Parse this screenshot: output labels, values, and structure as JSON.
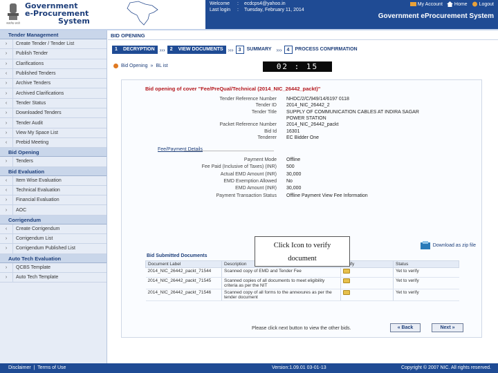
{
  "header": {
    "brand_line1": "Government",
    "brand_line2": "e-Procurement",
    "brand_line3": "System",
    "emblem_caption": "सत्यमेव जयते",
    "welcome_label": "Welcome",
    "welcome_value": "ecdcps4@yahoo.in",
    "last_login_label": "Last login",
    "last_login_value": "Tuesday, February 11, 2014",
    "my_account": "My Account",
    "home": "Home",
    "logout": "Logout",
    "system_title": "Government eProcurement System"
  },
  "sidebar": {
    "sections": [
      {
        "title": "Tender Management",
        "items": [
          {
            "bullet": "›",
            "label": "Create Tender / Tender List"
          },
          {
            "bullet": "›",
            "label": "Publish Tender"
          },
          {
            "bullet": "›",
            "label": "Clarifications"
          },
          {
            "bullet": "‹",
            "label": "Published Tenders"
          },
          {
            "bullet": "›",
            "label": "Archive Tenders"
          },
          {
            "bullet": "›",
            "label": "Archived Clarifications"
          },
          {
            "bullet": "‹",
            "label": "Tender Status"
          },
          {
            "bullet": "›",
            "label": "Downloaded Tenders"
          },
          {
            "bullet": "›",
            "label": "Tender Audit"
          },
          {
            "bullet": "›",
            "label": "View My Space List"
          },
          {
            "bullet": "‹",
            "label": "Prebid Meeting"
          }
        ]
      },
      {
        "title": "Bid Opening",
        "items": [
          {
            "bullet": "›",
            "label": "Tenders"
          }
        ]
      },
      {
        "title": "Bid Evaluation",
        "items": [
          {
            "bullet": "‹",
            "label": "Item Wise Evaluation"
          },
          {
            "bullet": "‹",
            "label": "Technical Evaluation"
          },
          {
            "bullet": "›",
            "label": "Financial Evaluation"
          },
          {
            "bullet": "›",
            "label": "AOC"
          }
        ]
      },
      {
        "title": "Corrigendum",
        "items": [
          {
            "bullet": "‹",
            "label": "Create Corrigendum"
          },
          {
            "bullet": "›",
            "label": "Corrigendum List"
          },
          {
            "bullet": "›",
            "label": "Corrigendum Published List"
          }
        ]
      },
      {
        "title": "Auto Tech Evaluation",
        "items": [
          {
            "bullet": "›",
            "label": "QCBS Template"
          },
          {
            "bullet": "›",
            "label": "Auto Tech Template"
          }
        ]
      }
    ]
  },
  "main": {
    "page_title": "BID OPENING",
    "steps": [
      {
        "num": "1",
        "label": "DECRYPTION"
      },
      {
        "num": "2",
        "label": "VIEW DOCUMENTS"
      },
      {
        "num": "3",
        "label": "SUMMARY"
      },
      {
        "num": "4",
        "label": "PROCESS CONFIRMATION"
      }
    ],
    "breadcrumb_1": "Bid Opening",
    "breadcrumb_sep": "»",
    "breadcrumb_2": "BL ist",
    "timer": "02 : 15",
    "panel_title": "Bid opening of cover \"Fee/PreQual/Technical (2014_NIC_26442_packt)\"",
    "info_rows": [
      {
        "k": "Tender Reference Number",
        "v": "NHDC/2/C/949/14/6197 0118"
      },
      {
        "k": "Tender ID",
        "v": "2014_NIC_26442_2"
      },
      {
        "k": "Tender Title",
        "v": "SUPPLY OF COMMUNICATION CABLES AT INDIRA SAGAR"
      },
      {
        "k": "",
        "v": "POWER STATION"
      },
      {
        "k": "Packet Reference Number",
        "v": "2014_NIC_26442_packt"
      },
      {
        "k": "Bid Id",
        "v": "16301"
      },
      {
        "k": "Tenderer",
        "v": "EC Bidder One"
      }
    ],
    "fee_details_label": "Fee/Payment Details",
    "fee_rows": [
      {
        "k": "Payment Mode",
        "v": "Offline"
      },
      {
        "k": "Fee Paid (Inclusive of Taxes) (INR)",
        "v": "500"
      },
      {
        "k": "Actual EMD Amount (INR)",
        "v": "30,000"
      },
      {
        "k": "EMD Exemption Allowed",
        "v": "No"
      },
      {
        "k": "EMD Amount (INR)",
        "v": "30,000"
      },
      {
        "k": "Payment Transaction Status",
        "v": "Offline Payment  View Fee Information"
      }
    ],
    "download_label": "Download as zip file",
    "tooltip_line1": "Click Icon to verify",
    "tooltip_line2": "document",
    "docs_title": "Bid Submitted Documents",
    "doc_headers": [
      "Document Label",
      "Description",
      "Verify",
      "Status"
    ],
    "docs": [
      {
        "label": "2014_NIC_26442_packt_71544",
        "desc": "Scanned copy of EMD and Tender Fee",
        "status": "Yet to verify"
      },
      {
        "label": "2014_NIC_26442_packt_71545",
        "desc": "Scanned copies of all documents to meet eligibility criteria as per the NIT",
        "status": "Yet to verify"
      },
      {
        "label": "2014_NIC_26442_packt_71546",
        "desc": "Scanned copy of all forms to the annexures as per the tender document",
        "status": "Yet to verify"
      }
    ],
    "instruction": "Please click next button to view the other bids.",
    "back_label": "« Back",
    "next_label": "Next »"
  },
  "footer": {
    "disclaimer": "Disclaimer",
    "sep": "|",
    "terms": "Terms of Use",
    "version": "Version:1.09.01 03-01-13",
    "copyright": "Copyright © 2007 NIC. All rights reserved."
  },
  "colors": {
    "brand_blue": "#1f4b94",
    "accent_orange": "#e8a13a",
    "title_red": "#b3161c",
    "sidebar_bg": "#e6ecf6"
  }
}
